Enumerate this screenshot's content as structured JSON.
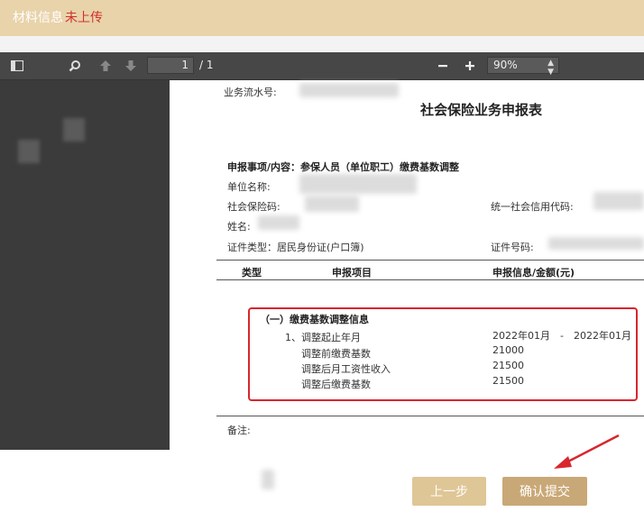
{
  "topbar": {
    "label": "材料信息",
    "status": "未上传"
  },
  "pdf_viewer": {
    "current_page": "1",
    "page_total": "/ 1",
    "zoom": "90%"
  },
  "document": {
    "serial_label": "业务流水号:",
    "title": "社会保险业务申报表",
    "declaration_item": "申报事项/内容：参保人员（单位职工）缴费基数调整",
    "unit_name_label": "单位名称:",
    "social_code_label": "社会保险码:",
    "credit_code_label": "统一社会信用代码:",
    "name_label": "姓名:",
    "id_type": "证件类型：居民身份证(户口簿)",
    "id_number_label": "证件号码:",
    "table_headers": [
      "类型",
      "申报项目",
      "申报信息/金额(元)"
    ],
    "section_title": "（一）缴费基数调整信息",
    "rows": [
      {
        "label": "1、调整起止年月",
        "value": "2022年01月　-　2022年01月"
      },
      {
        "label": "调整前缴费基数",
        "value": "21000"
      },
      {
        "label": "调整后月工资性收入",
        "value": "21500"
      },
      {
        "label": "调整后缴费基数",
        "value": "21500"
      }
    ],
    "remark_label": "备注:"
  },
  "buttons": {
    "prev": "上一步",
    "confirm": "确认提交"
  },
  "colors": {
    "highlight": "#d8262e",
    "topbar": "#e9d3aa",
    "confirm": "#c9a877"
  }
}
